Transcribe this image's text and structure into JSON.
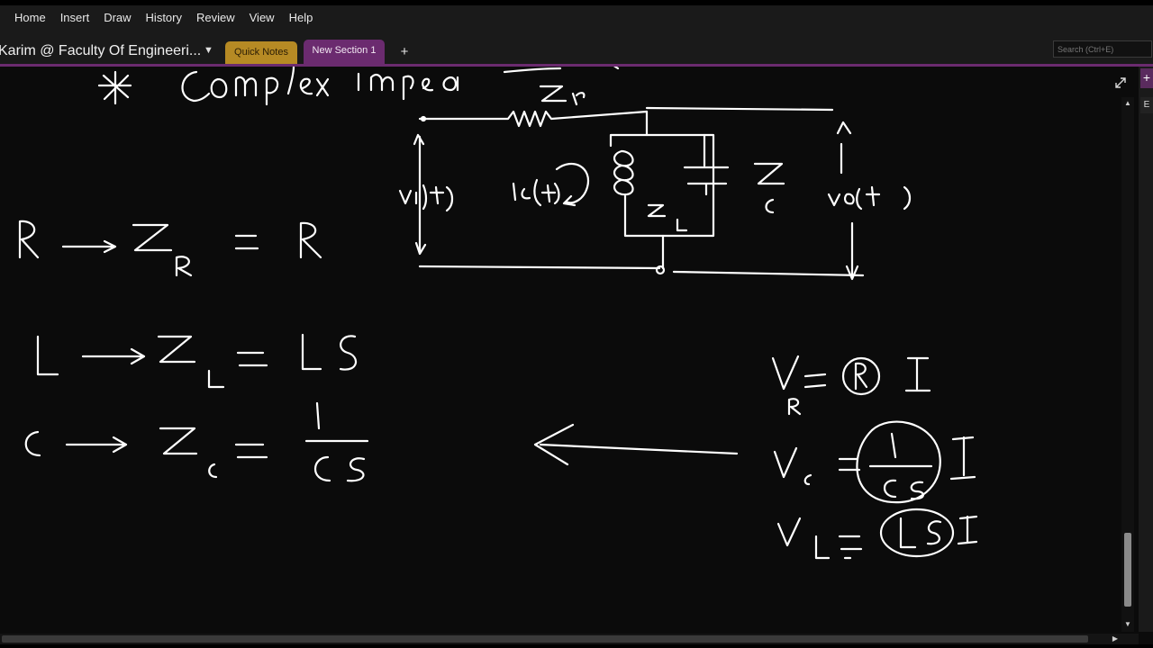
{
  "ribbon": {
    "tabs": [
      "Home",
      "Insert",
      "Draw",
      "History",
      "Review",
      "View",
      "Help"
    ]
  },
  "notebook": {
    "name": "Karim @ Faculty Of Engineeri...",
    "sections": [
      {
        "label": "Quick Notes"
      },
      {
        "label": "New Section 1"
      }
    ],
    "add_label": "+"
  },
  "search": {
    "placeholder": "Search (Ctrl+E)"
  },
  "right_panel": {
    "add_page_label": "+",
    "page_item_label": "E"
  },
  "colors": {
    "canvas_background": "#0b0b0b",
    "ink": "#ffffff",
    "section_accent": "#6b2b6f",
    "quick_notes_tab": "#b68a24"
  },
  "ink_icons": [
    "handwritten-ink-strokes"
  ]
}
